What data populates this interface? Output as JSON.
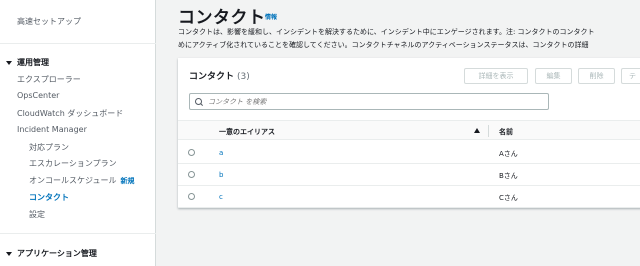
{
  "sidebar": {
    "quick_setup": "高速セットアップ",
    "operations_section": "運用管理",
    "items": {
      "explorer": "エクスプローラー",
      "opscenter": "OpsCenter",
      "cloudwatch_dashboard": "CloudWatch ダッシュボード",
      "incident_manager": "Incident Manager",
      "response_plans": "対応プラン",
      "escalation_plans": "エスカレーションプラン",
      "oncall_schedules": "オンコールスケジュール",
      "oncall_new_badge": "新規",
      "contacts": "コンタクト",
      "settings": "設定"
    },
    "app_section": "アプリケーション管理"
  },
  "page": {
    "title": "コンタクト",
    "info_link": "情報",
    "description_line1": "コンタクトは、影響を緩和し、インシデントを解決するために、インシデント中にエンゲージされます。注: コンタクトのコンタクト",
    "description_line2": "めにアクティブ化されていることを確認してください。コンタクトチャネルのアクティベーションステータスは、コンタクトの詳細"
  },
  "panel": {
    "title": "コンタクト",
    "count": "(3)",
    "buttons": {
      "view_details": "詳細を表示",
      "edit": "編集",
      "delete": "削除",
      "engage": "テ"
    },
    "search_placeholder": "コンタクト を検索",
    "columns": {
      "alias": "一意のエイリアス",
      "name": "名前"
    },
    "rows": [
      {
        "alias": "a",
        "name": "Aさん"
      },
      {
        "alias": "b",
        "name": "Bさん"
      },
      {
        "alias": "c",
        "name": "Cさん"
      }
    ]
  },
  "colors": {
    "link": "#0073bb",
    "border": "#d5dbdb",
    "background": "#f2f3f3"
  }
}
